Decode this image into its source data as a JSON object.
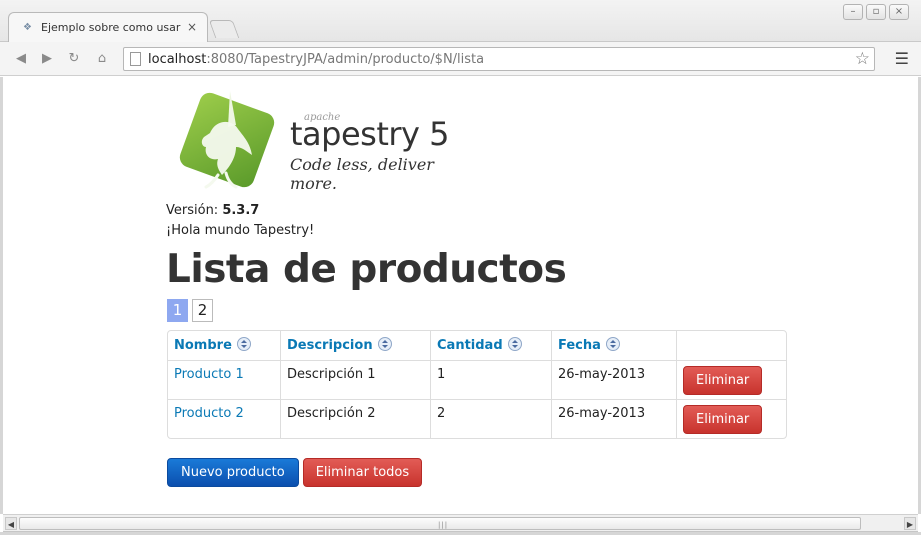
{
  "browser": {
    "tab_title": "Ejemplo sobre como usar",
    "tab_close": "×",
    "url_host": "localhost",
    "url_rest": ":8080/TapestryJPA/admin/producto/$N/lista",
    "icons": {
      "back": "back-arrow-icon",
      "forward": "forward-arrow-icon",
      "reload": "reload-icon",
      "home": "home-icon",
      "star": "bookmark-star-icon",
      "menu": "menu-icon"
    }
  },
  "logo": {
    "apache": "apache",
    "name": "tapestry 5",
    "tagline": "Code less, deliver more."
  },
  "version": {
    "label": "Versión:",
    "value": "5.3.7"
  },
  "hello": "¡Hola mundo Tapestry!",
  "page_title": "Lista de productos",
  "pager": {
    "pages": [
      "1",
      "2"
    ],
    "current": "1"
  },
  "table": {
    "headers": [
      "Nombre",
      "Descripcion",
      "Cantidad",
      "Fecha"
    ],
    "rows": [
      {
        "nombre": "Producto 1",
        "descripcion": "Descripción 1",
        "cantidad": "1",
        "fecha": "26-may-2013",
        "action": "Eliminar"
      },
      {
        "nombre": "Producto 2",
        "descripcion": "Descripción 2",
        "cantidad": "2",
        "fecha": "26-may-2013",
        "action": "Eliminar"
      }
    ]
  },
  "actions": {
    "new": "Nuevo producto",
    "delete_all": "Eliminar todos"
  },
  "colors": {
    "link": "#0a79b5",
    "primary": "#0b5cc6",
    "danger": "#d9403a",
    "pager_active": "#8ea8f0",
    "logo_green": "#7ab642"
  }
}
